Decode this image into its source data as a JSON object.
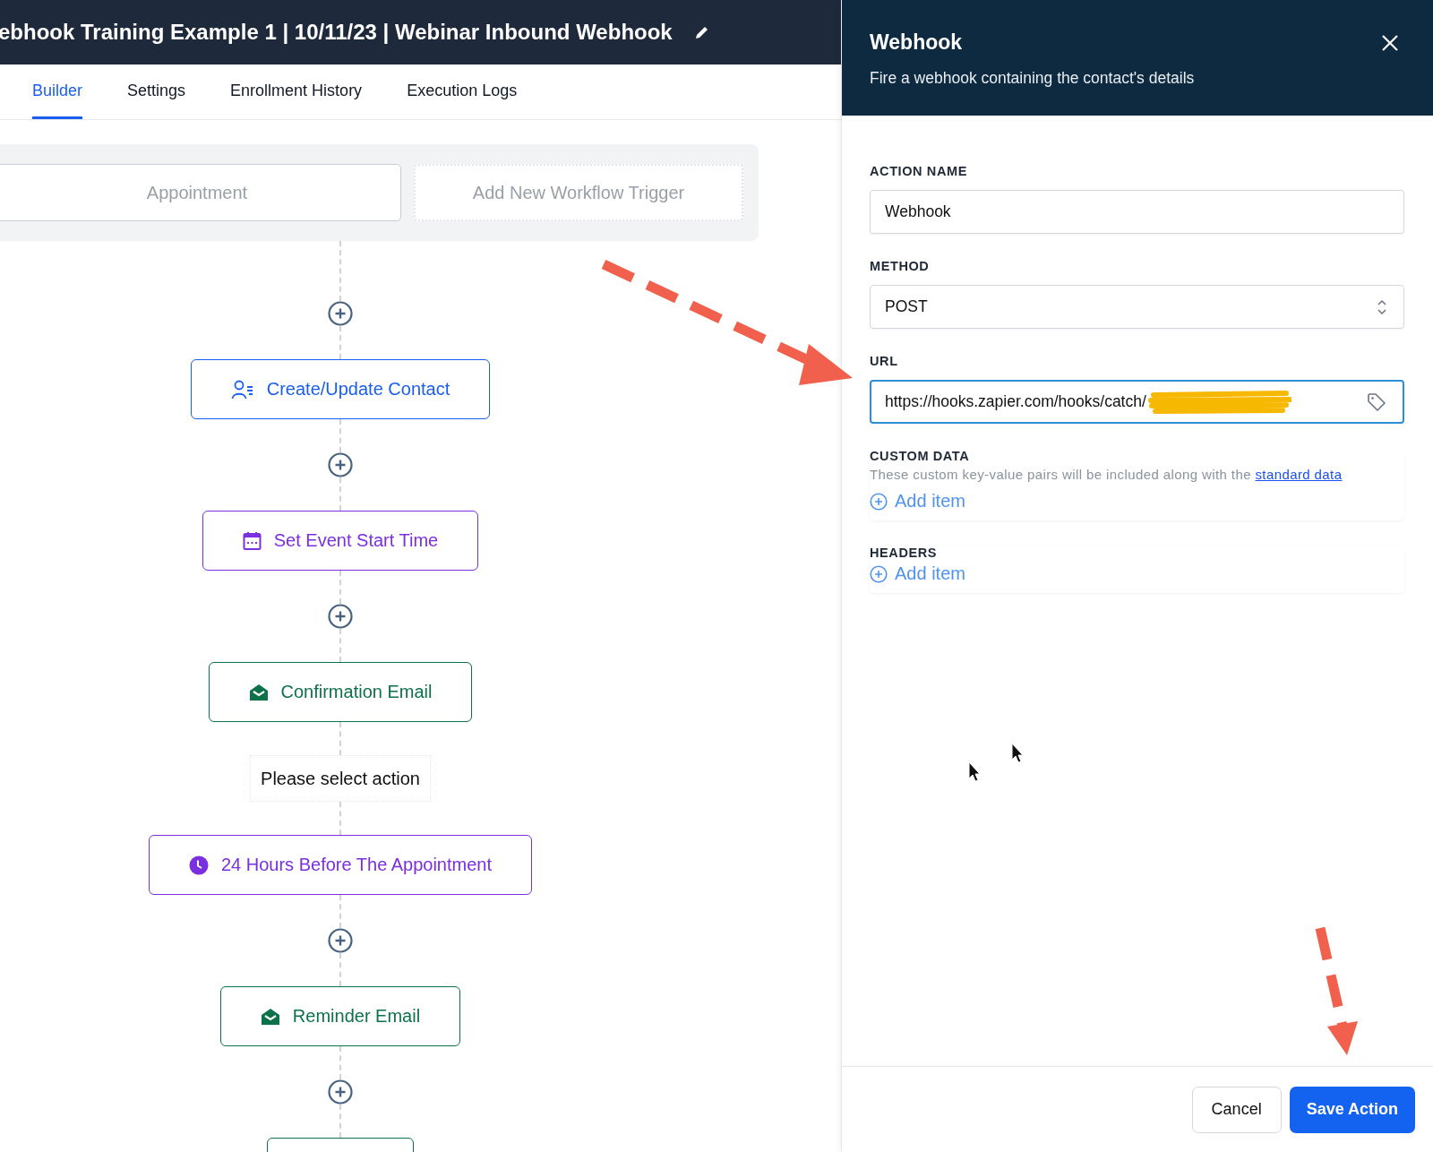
{
  "header": {
    "title": "ebhook Training Example 1 | 10/11/23 | Webinar Inbound Webhook"
  },
  "tabs": [
    {
      "label": "Builder",
      "selected": true
    },
    {
      "label": "Settings",
      "selected": false
    },
    {
      "label": "Enrollment History",
      "selected": false
    },
    {
      "label": "Execution Logs",
      "selected": false
    }
  ],
  "triggers": [
    {
      "kind": "trigger",
      "label": "Appointment"
    },
    {
      "kind": "add",
      "label": "Add New Workflow Trigger"
    }
  ],
  "flow": [
    {
      "kind": "add"
    },
    {
      "kind": "contact",
      "label": "Create/Update Contact",
      "color": "#1a5ef0"
    },
    {
      "kind": "add"
    },
    {
      "kind": "calendar",
      "label": "Set Event Start Time",
      "color": "#7a2fe0"
    },
    {
      "kind": "add"
    },
    {
      "kind": "email",
      "label": "Confirmation Email",
      "color": "#0d7149"
    },
    {
      "kind": "placeholder",
      "label": "Please select action"
    },
    {
      "kind": "clock",
      "label": "24 Hours Before The Appointment",
      "color": "#7a2fe0"
    },
    {
      "kind": "add"
    },
    {
      "kind": "email",
      "label": "Reminder Email",
      "color": "#0d7149"
    },
    {
      "kind": "add"
    },
    {
      "kind": "cut_node",
      "color": "#0d7149"
    }
  ],
  "panel": {
    "title": "Webhook",
    "subtitle": "Fire a webhook containing the contact's details",
    "fields": [
      {
        "kind": "text",
        "label": "ACTION NAME",
        "value": "Webhook",
        "focused": false
      },
      {
        "kind": "select",
        "label": "METHOD",
        "value": "POST",
        "focused": false
      },
      {
        "kind": "url",
        "label": "URL",
        "value": "https://hooks.zapier.com/hooks/catch/",
        "focused": true,
        "redacted": true
      }
    ],
    "sections": [
      {
        "label": "CUSTOM DATA",
        "description": "These custom key-value pairs will be included along with the",
        "link": "standard data",
        "add_label": "Add item"
      },
      {
        "label": "HEADERS",
        "add_label": "Add item"
      }
    ],
    "buttons": [
      {
        "kind": "secondary",
        "label": "Cancel"
      },
      {
        "kind": "primary",
        "label": "Save Action"
      }
    ]
  }
}
